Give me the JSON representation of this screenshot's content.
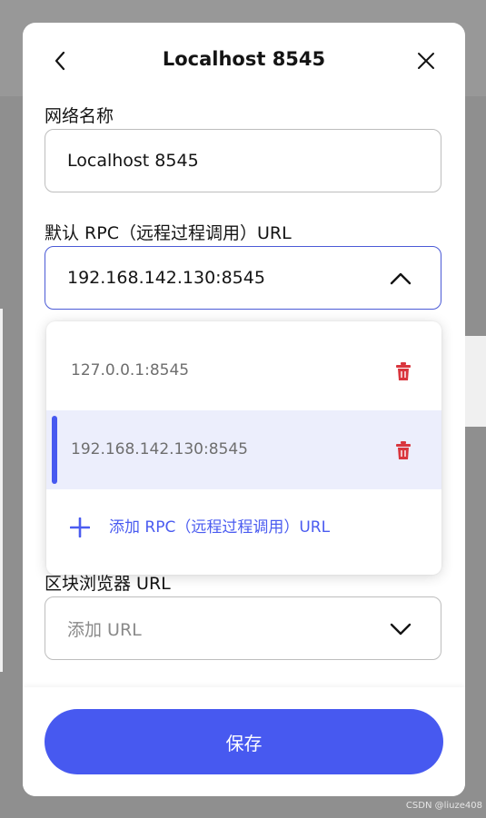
{
  "header": {
    "title": "Localhost 8545",
    "back_icon": "chevron-left-icon",
    "close_icon": "close-icon"
  },
  "network_name": {
    "label": "网络名称",
    "value": "Localhost 8545"
  },
  "rpc": {
    "label": "默认 RPC（远程过程调用）URL",
    "value": "192.168.142.130:8545",
    "chevron_icon": "chevron-up-icon",
    "options": [
      {
        "url": "127.0.0.1:8545",
        "selected": false,
        "delete_icon": "trash-icon"
      },
      {
        "url": "192.168.142.130:8545",
        "selected": true,
        "delete_icon": "trash-icon"
      }
    ],
    "add_label": "添加 RPC（远程过程调用）URL",
    "add_icon": "plus-icon"
  },
  "explorer": {
    "label": "区块浏览器 URL",
    "placeholder": "添加 URL",
    "chevron_icon": "chevron-down-icon"
  },
  "footer": {
    "save_label": "保存"
  },
  "watermark": "CSDN @liuze408",
  "colors": {
    "accent": "#4759f0",
    "delete": "#d9363e",
    "selected_bg": "#eceefc"
  }
}
